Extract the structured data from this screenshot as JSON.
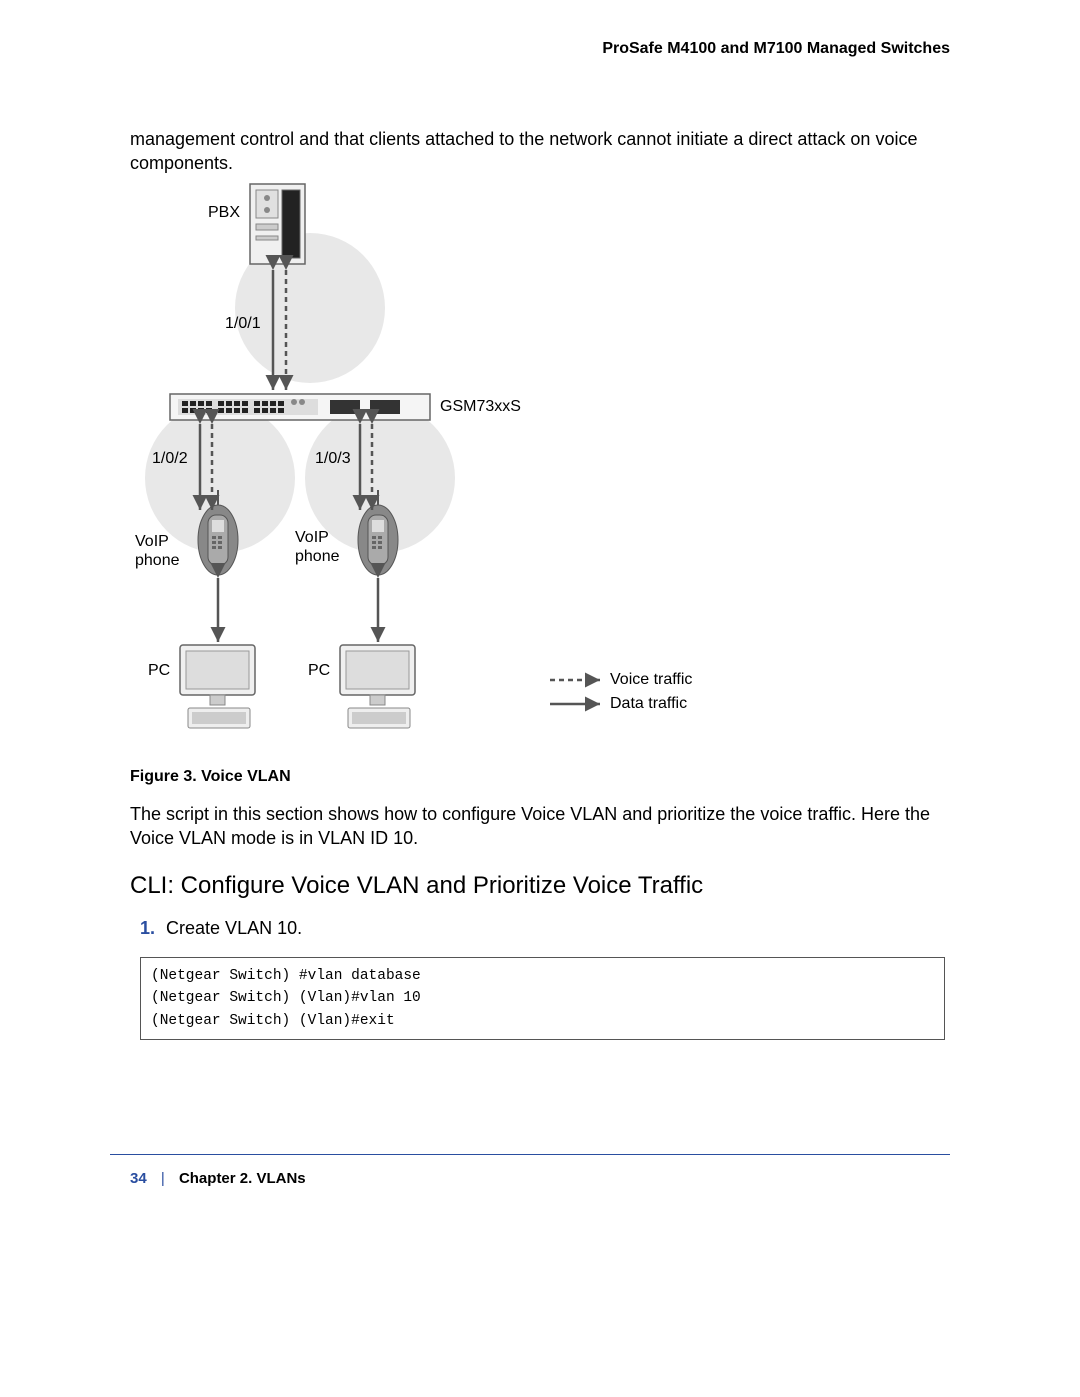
{
  "header": "ProSafe M4100 and M7100 Managed Switches",
  "intro": "management control and that clients attached to the network cannot initiate a direct attack on voice components.",
  "diagram": {
    "pbx": "PBX",
    "port1": "1/0/1",
    "port2": "1/0/2",
    "port3": "1/0/3",
    "switch": "GSM73xxS",
    "voip": "VoIP phone",
    "voip2": "VoIP phone",
    "pc": "PC",
    "pc2": "PC",
    "legend_voice": "Voice traffic",
    "legend_data": "Data traffic"
  },
  "figure_caption": "Figure 3. Voice VLAN",
  "after_figure": "The script in this section shows how to configure Voice VLAN and prioritize the voice traffic. Here the Voice VLAN mode is in VLAN ID 10.",
  "section_heading": "CLI: Configure Voice VLAN and Prioritize Voice Traffic",
  "step_num": "1.",
  "step_text": "Create VLAN 10.",
  "code": "(Netgear Switch) #vlan database\n(Netgear Switch) (Vlan)#vlan 10\n(Netgear Switch) (Vlan)#exit",
  "footer": {
    "page_num": "34",
    "chapter": "Chapter 2.  VLANs"
  }
}
